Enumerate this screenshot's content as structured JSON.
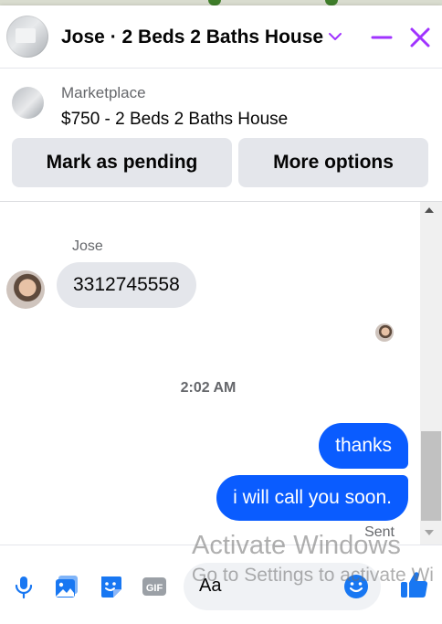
{
  "header": {
    "title": "Jose · 2 Beds 2 Baths House",
    "avatar_icon": "listing-photo",
    "chevron_icon": "chevron-down-icon",
    "minimize_icon": "minimize-icon",
    "close_icon": "close-icon",
    "accent_color": "#a033ff"
  },
  "listing": {
    "source_label": "Marketplace",
    "price_title": "$750 - 2 Beds 2 Baths House"
  },
  "actions": {
    "mark_pending": "Mark as pending",
    "more_options": "More options"
  },
  "messages": [
    {
      "sender": "Jose",
      "text": "3312745558",
      "direction": "incoming"
    },
    {
      "text": "thanks",
      "direction": "outgoing"
    },
    {
      "text": "i will call you soon.",
      "direction": "outgoing"
    }
  ],
  "timestamp": "2:02 AM",
  "status": "Sent",
  "composer": {
    "placeholder": "Aa",
    "icons": [
      "microphone-icon",
      "photo-icon",
      "sticker-icon",
      "gif-icon",
      "emoji-icon",
      "thumbs-up-icon"
    ],
    "gif_label": "GIF"
  },
  "colors": {
    "messenger_blue": "#0a5cff",
    "icon_blue": "#1877f2",
    "bubble_gray": "#e4e6eb"
  },
  "watermark": {
    "line1": "Activate Windows",
    "line2": "Go to Settings to activate Wi"
  }
}
